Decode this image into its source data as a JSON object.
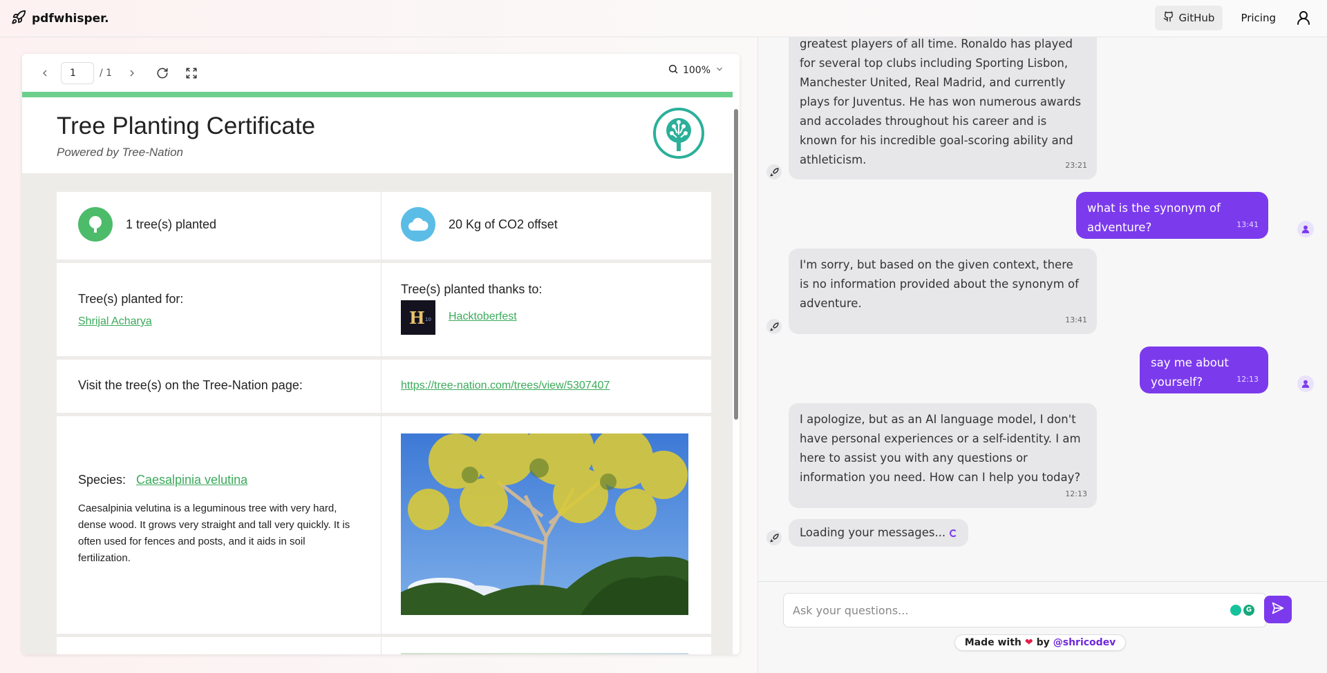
{
  "app": {
    "brand": "pdfwhisper."
  },
  "nav": {
    "github_label": "GitHub",
    "pricing_label": "Pricing"
  },
  "viewer": {
    "page_value": "1",
    "page_total": "/ 1",
    "zoom": "100%"
  },
  "certificate": {
    "title": "Tree Planting Certificate",
    "subtitle": "Powered by Tree-Nation",
    "trees_planted": "1 tree(s) planted",
    "co2": "20 Kg of CO2 offset",
    "planted_for_label": "Tree(s) planted for:",
    "planted_for_name": "Shrijal Acharya",
    "thanks_label": "Tree(s) planted thanks to:",
    "thanks_name": "Hacktoberfest",
    "visit_label": "Visit the tree(s) on the Tree-Nation page:",
    "visit_url": "https://tree-nation.com/trees/view/5307407",
    "species_label": "Species:",
    "species_name": "Caesalpinia velutina",
    "species_description": "Caesalpinia velutina is a leguminous tree with very hard, dense wood. It grows very straight and tall very quickly. It is often used for fences and posts, and it aids in soil fertilization."
  },
  "chat": {
    "messages": [
      {
        "role": "bot",
        "text": "greatest players of all time. Ronaldo has played for several top clubs including Sporting Lisbon, Manchester United, Real Madrid, and currently plays for Juventus. He has won numerous awards and accolades throughout his career and is known for his incredible goal-scoring ability and athleticism.",
        "time": "23:21"
      },
      {
        "role": "user",
        "text": "what is the synonym of adventure?",
        "time": "13:41"
      },
      {
        "role": "bot",
        "text": "I'm sorry, but based on the given context, there is no information provided about the synonym of adventure.",
        "time": "13:41"
      },
      {
        "role": "user",
        "text": "say me about yourself?",
        "time": "12:13"
      },
      {
        "role": "bot",
        "text": "I apologize, but as an AI language model, I don't have personal experiences or a self-identity. I am here to assist you with any questions or information you need. How can I help you today?",
        "time": "12:13"
      }
    ],
    "loading_text": "Loading your messages...",
    "input_placeholder": "Ask your questions...",
    "made_with_prefix": "Made with",
    "made_with_by": "by",
    "made_with_handle": "@shricodev"
  },
  "colors": {
    "accent": "#7c3aed",
    "green": "#3aaa5a",
    "bot_bubble": "#e7e7ea"
  }
}
